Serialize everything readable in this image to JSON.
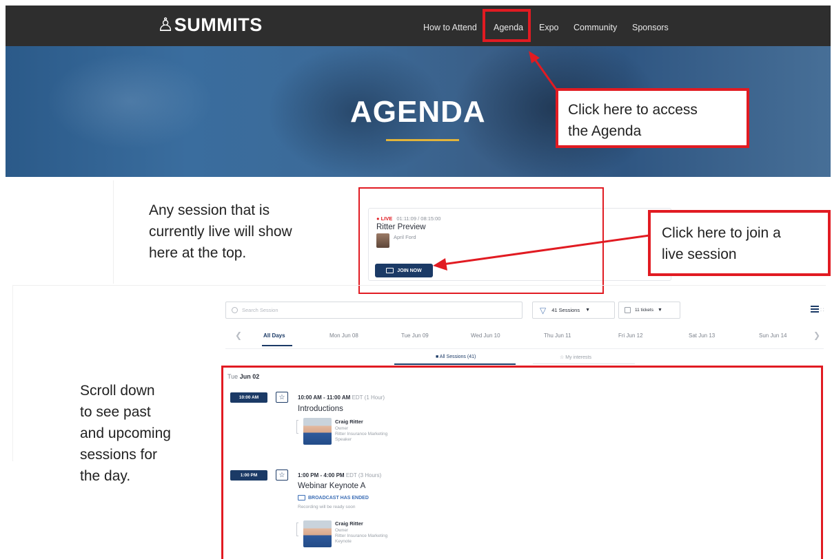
{
  "header": {
    "logo": "♙SUMMITS",
    "nav": [
      "How to Attend",
      "Agenda",
      "Expo",
      "Community",
      "Sponsors"
    ]
  },
  "hero": {
    "title": "AGENDA"
  },
  "callouts": {
    "agenda_line1": "Click here to access",
    "agenda_line2": "the Agenda",
    "join_line1": "Click here to join a",
    "join_line2": "live session"
  },
  "notes": {
    "live": [
      "Any session that is",
      "currently live will show",
      "here at the top."
    ],
    "scroll": [
      "Scroll down",
      "to see past",
      "and upcoming",
      "sessions for",
      "the day."
    ]
  },
  "live_session": {
    "status": "● LIVE",
    "time": "01:11:09 / 08:15:00",
    "title": "Ritter Preview",
    "speaker": "April Ford",
    "join_label": "JOIN NOW"
  },
  "search": {
    "placeholder": "Search Session"
  },
  "filters": {
    "sessions_label": "41 Sessions",
    "tickets_label": "11 tickets"
  },
  "days": [
    "All Days",
    "Mon Jun 08",
    "Tue Jun 09",
    "Wed Jun 10",
    "Thu Jun 11",
    "Fri Jun 12",
    "Sat Jun 13",
    "Sun Jun 14"
  ],
  "tabs": {
    "all_sessions": "All Sessions (41)",
    "my_interests": "My interests"
  },
  "list": {
    "date_prefix": "Tue",
    "date_bold": "Jun 02",
    "sessions": [
      {
        "pill": "10:00 AM",
        "time_range": "10:00 AM - 11:00 AM",
        "zone": "EDT",
        "duration": "(1 Hour)",
        "title": "Introductions",
        "speaker_name": "Craig Ritter",
        "speaker_role": "Owner",
        "speaker_company": "Ritter Insurance Marketing",
        "speaker_type": "Speaker"
      },
      {
        "pill": "1:00 PM",
        "time_range": "1:00 PM - 4:00 PM",
        "zone": "EDT",
        "duration": "(3 Hours)",
        "title": "Webinar Keynote A",
        "broadcast": "BROADCAST HAS ENDED",
        "recording": "Recording will be ready soon",
        "speaker_name": "Craig Ritter",
        "speaker_role": "Owner",
        "speaker_company": "Ritter Insurance Marketing",
        "speaker_type": "Keynote"
      }
    ]
  },
  "colors": {
    "annotation_red": "#e11b22",
    "navy": "#1b3a66",
    "header_bg": "#2e2e2e",
    "accent_gold": "#e2b43a"
  }
}
